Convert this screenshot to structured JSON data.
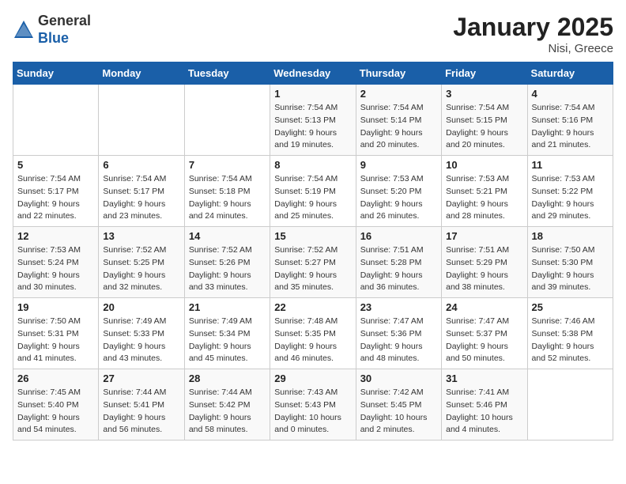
{
  "logo": {
    "general": "General",
    "blue": "Blue"
  },
  "title": "January 2025",
  "location": "Nisi, Greece",
  "days_header": [
    "Sunday",
    "Monday",
    "Tuesday",
    "Wednesday",
    "Thursday",
    "Friday",
    "Saturday"
  ],
  "weeks": [
    [
      {
        "day": "",
        "info": ""
      },
      {
        "day": "",
        "info": ""
      },
      {
        "day": "",
        "info": ""
      },
      {
        "day": "1",
        "info": "Sunrise: 7:54 AM\nSunset: 5:13 PM\nDaylight: 9 hours\nand 19 minutes."
      },
      {
        "day": "2",
        "info": "Sunrise: 7:54 AM\nSunset: 5:14 PM\nDaylight: 9 hours\nand 20 minutes."
      },
      {
        "day": "3",
        "info": "Sunrise: 7:54 AM\nSunset: 5:15 PM\nDaylight: 9 hours\nand 20 minutes."
      },
      {
        "day": "4",
        "info": "Sunrise: 7:54 AM\nSunset: 5:16 PM\nDaylight: 9 hours\nand 21 minutes."
      }
    ],
    [
      {
        "day": "5",
        "info": "Sunrise: 7:54 AM\nSunset: 5:17 PM\nDaylight: 9 hours\nand 22 minutes."
      },
      {
        "day": "6",
        "info": "Sunrise: 7:54 AM\nSunset: 5:17 PM\nDaylight: 9 hours\nand 23 minutes."
      },
      {
        "day": "7",
        "info": "Sunrise: 7:54 AM\nSunset: 5:18 PM\nDaylight: 9 hours\nand 24 minutes."
      },
      {
        "day": "8",
        "info": "Sunrise: 7:54 AM\nSunset: 5:19 PM\nDaylight: 9 hours\nand 25 minutes."
      },
      {
        "day": "9",
        "info": "Sunrise: 7:53 AM\nSunset: 5:20 PM\nDaylight: 9 hours\nand 26 minutes."
      },
      {
        "day": "10",
        "info": "Sunrise: 7:53 AM\nSunset: 5:21 PM\nDaylight: 9 hours\nand 28 minutes."
      },
      {
        "day": "11",
        "info": "Sunrise: 7:53 AM\nSunset: 5:22 PM\nDaylight: 9 hours\nand 29 minutes."
      }
    ],
    [
      {
        "day": "12",
        "info": "Sunrise: 7:53 AM\nSunset: 5:24 PM\nDaylight: 9 hours\nand 30 minutes."
      },
      {
        "day": "13",
        "info": "Sunrise: 7:52 AM\nSunset: 5:25 PM\nDaylight: 9 hours\nand 32 minutes."
      },
      {
        "day": "14",
        "info": "Sunrise: 7:52 AM\nSunset: 5:26 PM\nDaylight: 9 hours\nand 33 minutes."
      },
      {
        "day": "15",
        "info": "Sunrise: 7:52 AM\nSunset: 5:27 PM\nDaylight: 9 hours\nand 35 minutes."
      },
      {
        "day": "16",
        "info": "Sunrise: 7:51 AM\nSunset: 5:28 PM\nDaylight: 9 hours\nand 36 minutes."
      },
      {
        "day": "17",
        "info": "Sunrise: 7:51 AM\nSunset: 5:29 PM\nDaylight: 9 hours\nand 38 minutes."
      },
      {
        "day": "18",
        "info": "Sunrise: 7:50 AM\nSunset: 5:30 PM\nDaylight: 9 hours\nand 39 minutes."
      }
    ],
    [
      {
        "day": "19",
        "info": "Sunrise: 7:50 AM\nSunset: 5:31 PM\nDaylight: 9 hours\nand 41 minutes."
      },
      {
        "day": "20",
        "info": "Sunrise: 7:49 AM\nSunset: 5:33 PM\nDaylight: 9 hours\nand 43 minutes."
      },
      {
        "day": "21",
        "info": "Sunrise: 7:49 AM\nSunset: 5:34 PM\nDaylight: 9 hours\nand 45 minutes."
      },
      {
        "day": "22",
        "info": "Sunrise: 7:48 AM\nSunset: 5:35 PM\nDaylight: 9 hours\nand 46 minutes."
      },
      {
        "day": "23",
        "info": "Sunrise: 7:47 AM\nSunset: 5:36 PM\nDaylight: 9 hours\nand 48 minutes."
      },
      {
        "day": "24",
        "info": "Sunrise: 7:47 AM\nSunset: 5:37 PM\nDaylight: 9 hours\nand 50 minutes."
      },
      {
        "day": "25",
        "info": "Sunrise: 7:46 AM\nSunset: 5:38 PM\nDaylight: 9 hours\nand 52 minutes."
      }
    ],
    [
      {
        "day": "26",
        "info": "Sunrise: 7:45 AM\nSunset: 5:40 PM\nDaylight: 9 hours\nand 54 minutes."
      },
      {
        "day": "27",
        "info": "Sunrise: 7:44 AM\nSunset: 5:41 PM\nDaylight: 9 hours\nand 56 minutes."
      },
      {
        "day": "28",
        "info": "Sunrise: 7:44 AM\nSunset: 5:42 PM\nDaylight: 9 hours\nand 58 minutes."
      },
      {
        "day": "29",
        "info": "Sunrise: 7:43 AM\nSunset: 5:43 PM\nDaylight: 10 hours\nand 0 minutes."
      },
      {
        "day": "30",
        "info": "Sunrise: 7:42 AM\nSunset: 5:45 PM\nDaylight: 10 hours\nand 2 minutes."
      },
      {
        "day": "31",
        "info": "Sunrise: 7:41 AM\nSunset: 5:46 PM\nDaylight: 10 hours\nand 4 minutes."
      },
      {
        "day": "",
        "info": ""
      }
    ]
  ]
}
